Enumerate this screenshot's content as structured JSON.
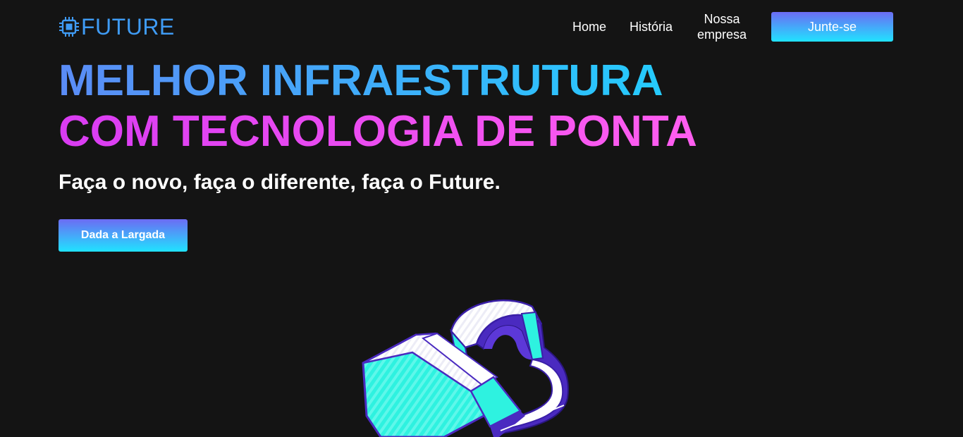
{
  "header": {
    "logo": {
      "icon": "chip-icon",
      "text": "FUTURE"
    },
    "nav": {
      "home": "Home",
      "historia": "História",
      "empresa": "Nossa empresa",
      "join_button": "Junte-se"
    }
  },
  "hero": {
    "title_line1": "MELHOR INFRAESTRUTURA",
    "title_line2": "COM TECNOLOGIA DE PONTA",
    "subtitle": "Faça o novo, faça o diferente, faça o Future.",
    "cta_button": "Dada a Largada",
    "illustration": "vr-headset-illustration"
  },
  "colors": {
    "background": "#141414",
    "logo_blue": "#3f9bf4",
    "gradient_blue_start": "#5b8cf6",
    "gradient_blue_end": "#25cbfd",
    "gradient_pink_start": "#d93cf2",
    "gradient_pink_end": "#ff5ef0",
    "button_top": "#6c6cf3",
    "button_bottom": "#20e3ff",
    "headset_teal": "#2ef2e0",
    "headset_purple": "#4a2ac0"
  }
}
